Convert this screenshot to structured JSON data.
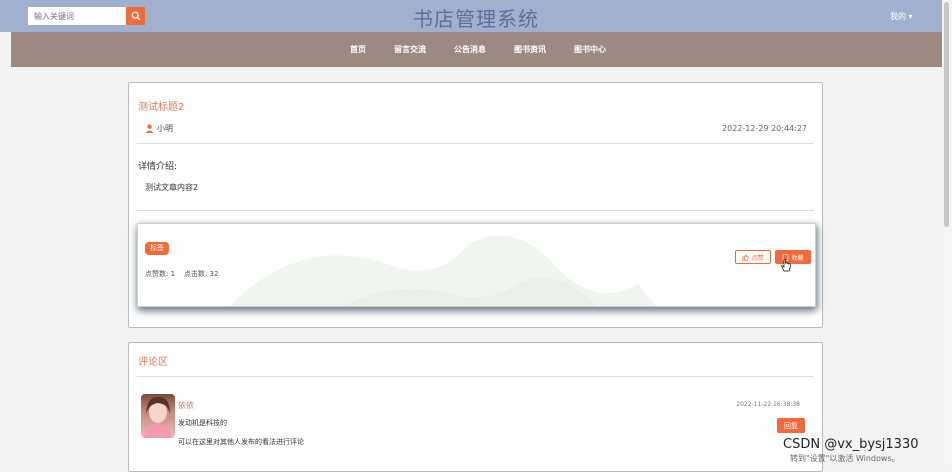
{
  "header": {
    "search_placeholder": "输入关键词",
    "title": "书店管理系统",
    "user_menu": "我的 ▾"
  },
  "nav": {
    "items": [
      "首页",
      "留言交流",
      "公告消息",
      "图书资讯",
      "图书中心"
    ]
  },
  "article": {
    "title": "测试标题2",
    "author": "小明",
    "date": "2022-12-29 20:44:27",
    "detail_label": "详情介绍:",
    "content": "测试文章内容2",
    "tag": "标签",
    "stats": "点赞数: 1    点击数: 32",
    "like_label": "点赞",
    "favorite_label": "收藏"
  },
  "comments": {
    "section_title": "评论区",
    "items": [
      {
        "name": "依依",
        "text": "发动机是科技的",
        "sub": "可以在这里对其他人发布的看法进行评论",
        "date": "2022-11-22 16:38:38",
        "reply_label": "回复"
      }
    ]
  },
  "overlay": {
    "watermark": "CSDN @vx_bysj1330",
    "windows_text": "转到\"设置\"以激活 Windows。"
  },
  "colors": {
    "topbar": "#9fb1cf",
    "navbar": "#9c8a82",
    "accent": "#f06a3a",
    "title_text": "#e07a58"
  }
}
